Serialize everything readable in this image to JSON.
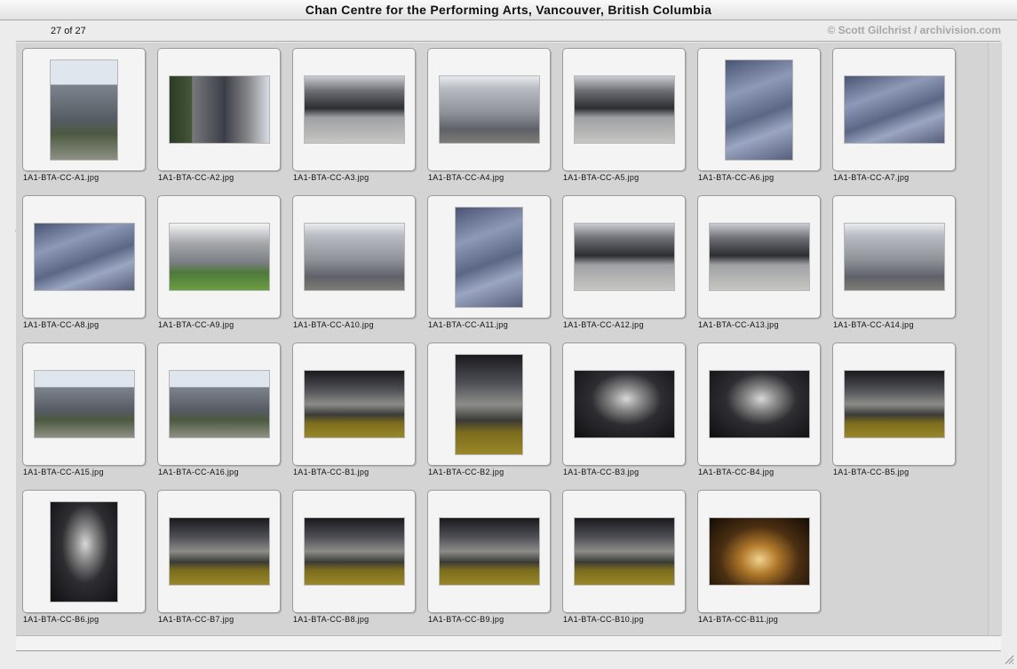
{
  "window": {
    "title": "Chan Centre for the Performing Arts, Vancouver, British Columbia"
  },
  "toolbar": {
    "counter": "27 of 27",
    "credit": "© Scott Gilchrist / archivision.com"
  },
  "thumbnails": [
    {
      "file": "1A1-BTA-CC-A1.jpg",
      "orientation": "portrait",
      "tone": "ext"
    },
    {
      "file": "1A1-BTA-CC-A2.jpg",
      "orientation": "landscape",
      "tone": "tree"
    },
    {
      "file": "1A1-BTA-CC-A3.jpg",
      "orientation": "landscape",
      "tone": "entry"
    },
    {
      "file": "1A1-BTA-CC-A4.jpg",
      "orientation": "landscape",
      "tone": "grey"
    },
    {
      "file": "1A1-BTA-CC-A5.jpg",
      "orientation": "landscape",
      "tone": "entry"
    },
    {
      "file": "1A1-BTA-CC-A6.jpg",
      "orientation": "portrait",
      "tone": "blue"
    },
    {
      "file": "1A1-BTA-CC-A7.jpg",
      "orientation": "landscape",
      "tone": "blue"
    },
    {
      "file": "1A1-BTA-CC-A8.jpg",
      "orientation": "landscape",
      "tone": "blue"
    },
    {
      "file": "1A1-BTA-CC-A9.jpg",
      "orientation": "landscape",
      "tone": "green"
    },
    {
      "file": "1A1-BTA-CC-A10.jpg",
      "orientation": "landscape",
      "tone": "grey"
    },
    {
      "file": "1A1-BTA-CC-A11.jpg",
      "orientation": "portrait",
      "tone": "blue"
    },
    {
      "file": "1A1-BTA-CC-A12.jpg",
      "orientation": "landscape",
      "tone": "entry"
    },
    {
      "file": "1A1-BTA-CC-A13.jpg",
      "orientation": "landscape",
      "tone": "entry"
    },
    {
      "file": "1A1-BTA-CC-A14.jpg",
      "orientation": "landscape",
      "tone": "grey"
    },
    {
      "file": "1A1-BTA-CC-A15.jpg",
      "orientation": "landscape",
      "tone": "ext"
    },
    {
      "file": "1A1-BTA-CC-A16.jpg",
      "orientation": "landscape",
      "tone": "ext"
    },
    {
      "file": "1A1-BTA-CC-B1.jpg",
      "orientation": "landscape",
      "tone": "int"
    },
    {
      "file": "1A1-BTA-CC-B2.jpg",
      "orientation": "portrait",
      "tone": "int"
    },
    {
      "file": "1A1-BTA-CC-B3.jpg",
      "orientation": "landscape",
      "tone": "mural"
    },
    {
      "file": "1A1-BTA-CC-B4.jpg",
      "orientation": "landscape",
      "tone": "mural"
    },
    {
      "file": "1A1-BTA-CC-B5.jpg",
      "orientation": "landscape",
      "tone": "int"
    },
    {
      "file": "1A1-BTA-CC-B6.jpg",
      "orientation": "portrait",
      "tone": "mural"
    },
    {
      "file": "1A1-BTA-CC-B7.jpg",
      "orientation": "landscape",
      "tone": "int"
    },
    {
      "file": "1A1-BTA-CC-B8.jpg",
      "orientation": "landscape",
      "tone": "int"
    },
    {
      "file": "1A1-BTA-CC-B9.jpg",
      "orientation": "landscape",
      "tone": "int"
    },
    {
      "file": "1A1-BTA-CC-B10.jpg",
      "orientation": "landscape",
      "tone": "int"
    },
    {
      "file": "1A1-BTA-CC-B11.jpg",
      "orientation": "landscape",
      "tone": "stage"
    }
  ]
}
